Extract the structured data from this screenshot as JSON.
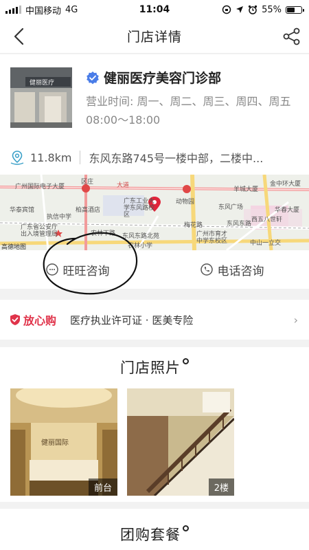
{
  "status_bar": {
    "carrier": "中国移动",
    "network": "4G",
    "time": "11:04",
    "battery": "55%",
    "battery_level": 0.55
  },
  "nav": {
    "title": "门店详情",
    "back_icon": "chevron-left-icon",
    "share_icon": "share-icon"
  },
  "store": {
    "name": "健丽医疗美容门诊部",
    "photo_sign": "健丽医疗",
    "hours_label": "营业时间:",
    "hours_days": "周一、周二、周三、周四、周五",
    "hours_time": "08:00～18:00",
    "distance": "11.8km",
    "address": "东风东路745号一楼中部，二楼中..."
  },
  "map": {
    "labels": [
      "广州国际电子大厦",
      "区庄",
      "羊城大厦",
      "金中环大厦",
      "华泰宾馆",
      "柏高酒店",
      "广东工业大学东风路校区",
      "动物园",
      "东风广场",
      "华春大厦",
      "执信中学",
      "梅花路",
      "广东省公安厅出入境管理局",
      "农林下路",
      "东风东路",
      "东风东路北苑",
      "西五八世轩",
      "广州市育才中学东校区",
      "中山一立交",
      "农林小学",
      "高德地图"
    ],
    "road_label": "大道"
  },
  "actions": {
    "wangwang": "旺旺咨询",
    "phone": "电话咨询"
  },
  "guarantee": {
    "title": "放心购",
    "desc": "医疗执业许可证 · 医美专险"
  },
  "photos": {
    "title": "门店照片",
    "items": [
      {
        "tag": "前台",
        "sign": "健丽国际"
      },
      {
        "tag": "2楼"
      }
    ]
  },
  "group_buy": {
    "title": "团购套餐"
  },
  "colors": {
    "accent_red": "#e0334a",
    "verified_blue": "#4a7de8",
    "text_gray": "#888888"
  }
}
